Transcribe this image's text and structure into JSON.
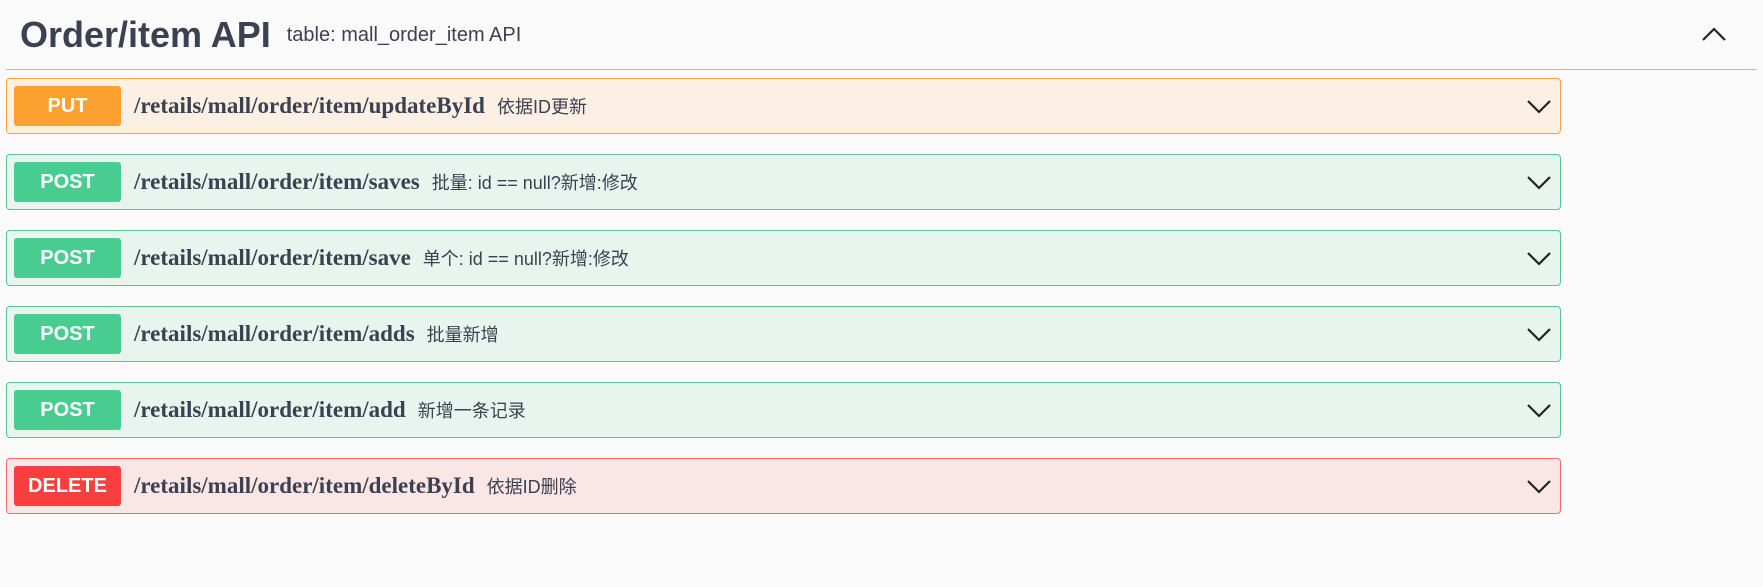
{
  "tag": {
    "title": "Order/item API",
    "description": "table: mall_order_item API"
  },
  "operations": [
    {
      "method": "PUT",
      "path": "/retails/mall/order/item/updateById",
      "summary": "依据ID更新"
    },
    {
      "method": "POST",
      "path": "/retails/mall/order/item/saves",
      "summary": "批量: id == null?新增:修改"
    },
    {
      "method": "POST",
      "path": "/retails/mall/order/item/save",
      "summary": "单个: id == null?新增:修改"
    },
    {
      "method": "POST",
      "path": "/retails/mall/order/item/adds",
      "summary": "批量新增"
    },
    {
      "method": "POST",
      "path": "/retails/mall/order/item/add",
      "summary": "新增一条记录"
    },
    {
      "method": "DELETE",
      "path": "/retails/mall/order/item/deleteById",
      "summary": "依据ID删除"
    }
  ],
  "colors": {
    "put": "#fca130",
    "post": "#49cc90",
    "delete": "#f93e3e",
    "text": "#3b4151"
  },
  "icons": {
    "collapse": "chevron-up-icon",
    "expand": "chevron-down-icon"
  }
}
